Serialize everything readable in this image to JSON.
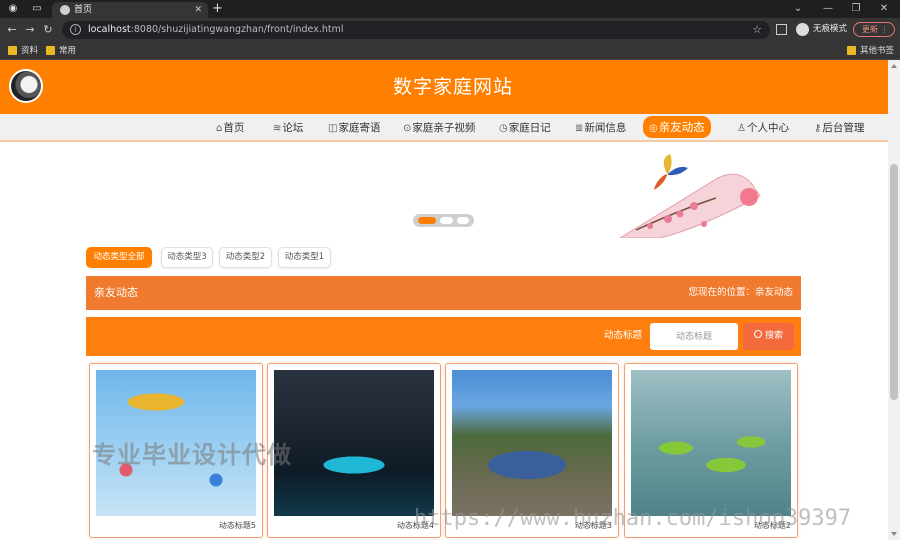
{
  "browser": {
    "tab_title": "首页",
    "new_tab_symbol": "+",
    "url_host": "localhost",
    "url_rest": ":8080/shuzijiatingwangzhan/front/index.html",
    "incognito_label": "无痕模式",
    "update_label": "更新",
    "bookmarks": [
      "资料",
      "常用"
    ],
    "other_bookmarks": "其他书签"
  },
  "site": {
    "title": "数字家庭网站"
  },
  "nav": {
    "items": [
      {
        "icon": "⌂",
        "label": "首页"
      },
      {
        "icon": "≋",
        "label": "论坛"
      },
      {
        "icon": "◫",
        "label": "家庭寄语"
      },
      {
        "icon": "⊙",
        "label": "家庭亲子视频"
      },
      {
        "icon": "◷",
        "label": "家庭日记"
      },
      {
        "icon": "≣",
        "label": "新闻信息"
      },
      {
        "icon": "◎",
        "label": "亲友动态"
      },
      {
        "icon": "♙",
        "label": "个人中心"
      },
      {
        "icon": "⚷",
        "label": "后台管理"
      }
    ],
    "active_index": 6
  },
  "filters": [
    "动态类型全部",
    "动态类型3",
    "动态类型2",
    "动态类型1"
  ],
  "breadcrumb": {
    "title": "亲友动态",
    "location": "您现在的位置：亲友动态"
  },
  "search": {
    "label": "动态标题",
    "placeholder": "动态标题",
    "button": "搜索"
  },
  "cards": [
    {
      "caption": "动态标题5"
    },
    {
      "caption": "动态标题4"
    },
    {
      "caption": "动态标题3"
    },
    {
      "caption": "动态标题2"
    }
  ],
  "watermarks": {
    "cn": "专业毕业设计代做",
    "url": "https://www.huzhan.com/ishop39397"
  },
  "colors": {
    "brand": "#ff8000",
    "breadcrumb": "#f07a2e",
    "search_button": "#f36b3d"
  }
}
